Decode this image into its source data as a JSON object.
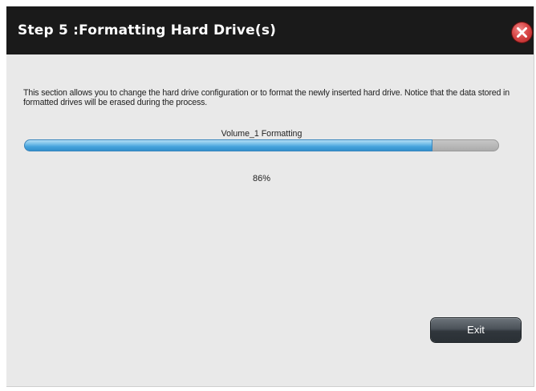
{
  "dialog": {
    "title": "Step 5 :Formatting Hard Drive(s)",
    "close_icon": "close-icon"
  },
  "content": {
    "description": "This section allows you to change the hard drive configuration or to format the newly inserted hard drive. Notice that the data stored in formatted drives will be erased during the process.",
    "progress_label": "Volume_1 Formatting",
    "progress_percent_text": "86%",
    "progress_fraction": 0.86
  },
  "footer": {
    "exit_label": "Exit"
  },
  "colors": {
    "title_bar": "#1a1a1a",
    "dialog_background": "#e9e9e9",
    "progress_fill": "#46a3dc",
    "progress_track": "#b9b9b9",
    "close_button": "#d94848",
    "exit_button": "#3a4046"
  }
}
